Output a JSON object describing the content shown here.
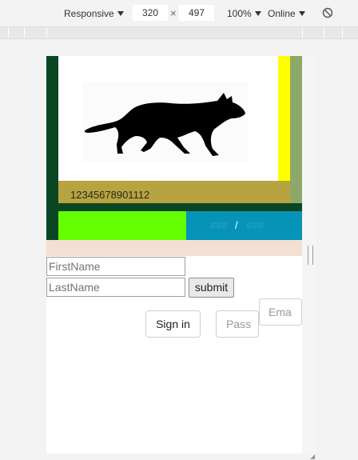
{
  "devtools": {
    "device": "Responsive",
    "width": "320",
    "times": "×",
    "height": "497",
    "zoom": "100%",
    "network": "Online"
  },
  "page": {
    "caption_number": "12345678901112",
    "nav_left": "###",
    "nav_separator": "/",
    "nav_right": "###",
    "form": {
      "firstname_placeholder": "FirstName",
      "lastname_placeholder": "LastName",
      "submit_label": "submit"
    },
    "auth": {
      "signin_label": "Sign in",
      "password_label": "Pass",
      "email_label": "Ema"
    }
  },
  "colors": {
    "dark_green": "#0a4623",
    "olive_bar": "#b7a340",
    "lime": "#66ff00",
    "blue": "#0693b8",
    "yellow": "#ffff00",
    "peach": "#f1e0d3"
  }
}
